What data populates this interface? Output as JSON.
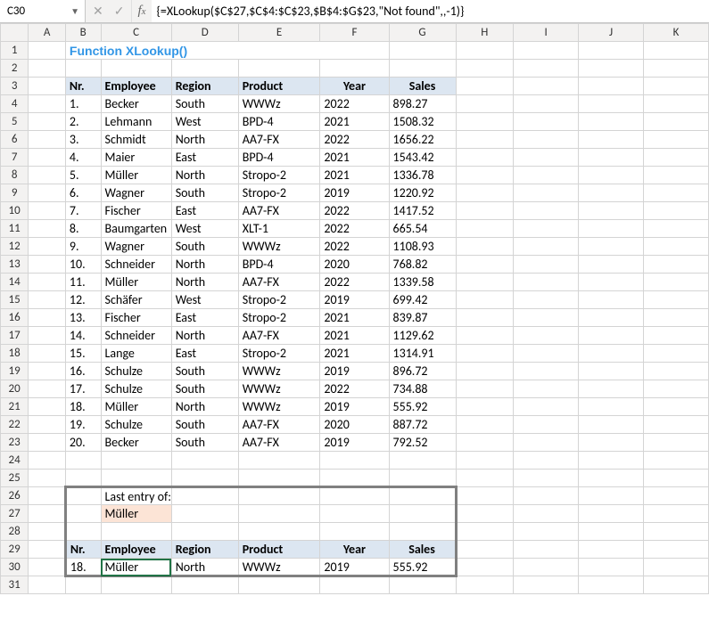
{
  "nameBox": "C30",
  "formula": "{=XLookup($C$27,$C$4:$C$23,$B$4:$G$23,\"Not found\",,-1)}",
  "title": "Function XLookup()",
  "columns": [
    "A",
    "B",
    "C",
    "D",
    "E",
    "F",
    "G",
    "H",
    "I",
    "J",
    "K"
  ],
  "tableHeader": {
    "nr": "Nr.",
    "emp": "Employee",
    "reg": "Region",
    "prod": "Product",
    "year": "Year",
    "sales": "Sales"
  },
  "rows": [
    {
      "nr": "1.",
      "emp": "Becker",
      "reg": "South",
      "prod": "WWWz",
      "year": "2022",
      "sales": "898.27"
    },
    {
      "nr": "2.",
      "emp": "Lehmann",
      "reg": "West",
      "prod": "BPD-4",
      "year": "2021",
      "sales": "1508.32"
    },
    {
      "nr": "3.",
      "emp": "Schmidt",
      "reg": "North",
      "prod": "AA7-FX",
      "year": "2022",
      "sales": "1656.22"
    },
    {
      "nr": "4.",
      "emp": "Maier",
      "reg": "East",
      "prod": "BPD-4",
      "year": "2021",
      "sales": "1543.42"
    },
    {
      "nr": "5.",
      "emp": "Müller",
      "reg": "North",
      "prod": "Stropo-2",
      "year": "2021",
      "sales": "1336.78"
    },
    {
      "nr": "6.",
      "emp": "Wagner",
      "reg": "South",
      "prod": "Stropo-2",
      "year": "2019",
      "sales": "1220.92"
    },
    {
      "nr": "7.",
      "emp": "Fischer",
      "reg": "East",
      "prod": "AA7-FX",
      "year": "2022",
      "sales": "1417.52"
    },
    {
      "nr": "8.",
      "emp": "Baumgarten",
      "reg": "West",
      "prod": "XLT-1",
      "year": "2022",
      "sales": "665.54"
    },
    {
      "nr": "9.",
      "emp": "Wagner",
      "reg": "South",
      "prod": "WWWz",
      "year": "2022",
      "sales": "1108.93"
    },
    {
      "nr": "10.",
      "emp": "Schneider",
      "reg": "North",
      "prod": "BPD-4",
      "year": "2020",
      "sales": "768.82"
    },
    {
      "nr": "11.",
      "emp": "Müller",
      "reg": "North",
      "prod": "AA7-FX",
      "year": "2022",
      "sales": "1339.58"
    },
    {
      "nr": "12.",
      "emp": "Schäfer",
      "reg": "West",
      "prod": "Stropo-2",
      "year": "2019",
      "sales": "699.42"
    },
    {
      "nr": "13.",
      "emp": "Fischer",
      "reg": "East",
      "prod": "Stropo-2",
      "year": "2021",
      "sales": "839.87"
    },
    {
      "nr": "14.",
      "emp": "Schneider",
      "reg": "North",
      "prod": "AA7-FX",
      "year": "2021",
      "sales": "1129.62"
    },
    {
      "nr": "15.",
      "emp": "Lange",
      "reg": "East",
      "prod": "Stropo-2",
      "year": "2021",
      "sales": "1314.91"
    },
    {
      "nr": "16.",
      "emp": "Schulze",
      "reg": "South",
      "prod": "WWWz",
      "year": "2019",
      "sales": "896.72"
    },
    {
      "nr": "17.",
      "emp": "Schulze",
      "reg": "South",
      "prod": "WWWz",
      "year": "2022",
      "sales": "734.88"
    },
    {
      "nr": "18.",
      "emp": "Müller",
      "reg": "North",
      "prod": "WWWz",
      "year": "2019",
      "sales": "555.92"
    },
    {
      "nr": "19.",
      "emp": "Schulze",
      "reg": "South",
      "prod": "AA7-FX",
      "year": "2020",
      "sales": "887.72"
    },
    {
      "nr": "20.",
      "emp": "Becker",
      "reg": "South",
      "prod": "AA7-FX",
      "year": "2019",
      "sales": "792.52"
    }
  ],
  "lookup": {
    "label": "Last entry of:",
    "value": "Müller"
  },
  "result": {
    "nr": "18.",
    "emp": "Müller",
    "reg": "North",
    "prod": "WWWz",
    "year": "2019",
    "sales": "555.92"
  },
  "colWidths": {
    "corner": 30,
    "A": 40,
    "B": 38,
    "C": 76,
    "D": 72,
    "E": 88,
    "F": 74,
    "G": 72,
    "H": 62,
    "I": 70,
    "J": 70,
    "K": 70
  }
}
